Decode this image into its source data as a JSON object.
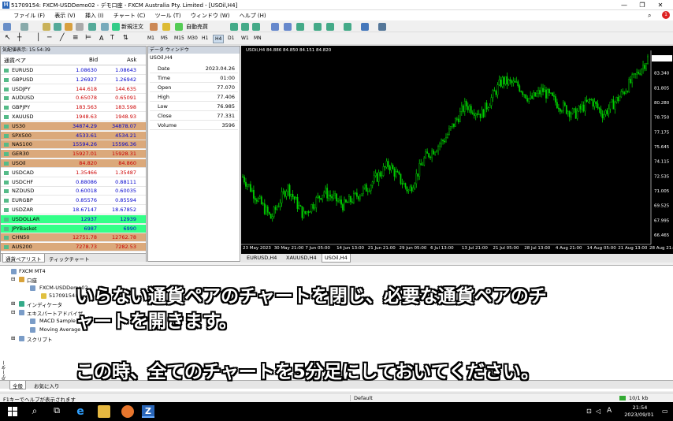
{
  "title_bar": {
    "title": "51709154: FXCM-USDDemo02 - デモ口座 - FXCM Australia Pty. Limited - [USOil,H4]",
    "controls": [
      "—",
      "❐",
      "✕"
    ]
  },
  "menu": [
    "ファイル (F)",
    "表示 (V)",
    "挿入 (I)",
    "チャート (C)",
    "ツール (T)",
    "ウィンドウ (W)",
    "ヘルプ (H)"
  ],
  "toolbar": {
    "new_order": "新規注文",
    "auto_trading": "自動売買"
  },
  "timeframes": [
    "M1",
    "M5",
    "M15",
    "M30",
    "H1",
    "H4",
    "D1",
    "W1",
    "MN"
  ],
  "market_watch": {
    "header": "気配値表示: 15:54:39",
    "columns": {
      "symbol": "通貨ペア",
      "bid": "Bid",
      "ask": "Ask"
    },
    "rows": [
      {
        "symbol": "EURUSD",
        "bid": "1.08630",
        "ask": "1.08643",
        "bg": "#ffffff",
        "color": "#0000cc"
      },
      {
        "symbol": "GBPUSD",
        "bid": "1.26927",
        "ask": "1.26942",
        "bg": "#ffffff",
        "color": "#0000cc"
      },
      {
        "symbol": "USDJPY",
        "bid": "144.618",
        "ask": "144.635",
        "bg": "#ffffff",
        "color": "#cc0000"
      },
      {
        "symbol": "AUDUSD",
        "bid": "0.65078",
        "ask": "0.65091",
        "bg": "#ffffff",
        "color": "#cc0000"
      },
      {
        "symbol": "GBPJPY",
        "bid": "183.563",
        "ask": "183.598",
        "bg": "#ffffff",
        "color": "#cc0000"
      },
      {
        "symbol": "XAUUSD",
        "bid": "1948.63",
        "ask": "1948.93",
        "bg": "#ffffff",
        "color": "#cc0000"
      },
      {
        "symbol": "US30",
        "bid": "34874.29",
        "ask": "34878.07",
        "bg": "#dba97b",
        "color": "#0000cc"
      },
      {
        "symbol": "SPX500",
        "bid": "4533.61",
        "ask": "4534.21",
        "bg": "#dba97b",
        "color": "#0000cc"
      },
      {
        "symbol": "NAS100",
        "bid": "15594.26",
        "ask": "15596.36",
        "bg": "#dba97b",
        "color": "#0000cc"
      },
      {
        "symbol": "GER30",
        "bid": "15927.01",
        "ask": "15928.31",
        "bg": "#dba97b",
        "color": "#cc0000"
      },
      {
        "symbol": "USOil",
        "bid": "84.820",
        "ask": "84.860",
        "bg": "#dba97b",
        "color": "#cc0000"
      },
      {
        "symbol": "USDCAD",
        "bid": "1.35466",
        "ask": "1.35487",
        "bg": "#ffffff",
        "color": "#cc0000"
      },
      {
        "symbol": "USDCHF",
        "bid": "0.88086",
        "ask": "0.88111",
        "bg": "#ffffff",
        "color": "#0000cc"
      },
      {
        "symbol": "NZDUSD",
        "bid": "0.60018",
        "ask": "0.60035",
        "bg": "#ffffff",
        "color": "#0000cc"
      },
      {
        "symbol": "EURGBP",
        "bid": "0.85576",
        "ask": "0.85594",
        "bg": "#ffffff",
        "color": "#0000cc"
      },
      {
        "symbol": "USDZAR",
        "bid": "18.67147",
        "ask": "18.67852",
        "bg": "#ffffff",
        "color": "#0000cc"
      },
      {
        "symbol": "USDOLLAR",
        "bid": "12937",
        "ask": "12939",
        "bg": "#33ff88",
        "color": "#0000cc"
      },
      {
        "symbol": "JPYBasket",
        "bid": "6987",
        "ask": "6990",
        "bg": "#33ff88",
        "color": "#0000cc"
      },
      {
        "symbol": "CHN50",
        "bid": "12751.78",
        "ask": "12762.78",
        "bg": "#dba97b",
        "color": "#cc0000"
      },
      {
        "symbol": "AUS200",
        "bid": "7278.73",
        "ask": "7282.53",
        "bg": "#dba97b",
        "color": "#cc0000"
      }
    ],
    "tabs": [
      "通貨ペアリスト",
      "ティックチャート"
    ]
  },
  "data_window": {
    "header": "データ ウィンドウ",
    "symbol": "USOil,H4",
    "rows": [
      {
        "k": "Date",
        "v": "2023.04.26"
      },
      {
        "k": "Time",
        "v": "01:00"
      },
      {
        "k": "Open",
        "v": "77.070"
      },
      {
        "k": "High",
        "v": "77.406"
      },
      {
        "k": "Low",
        "v": "76.985"
      },
      {
        "k": "Close",
        "v": "77.331"
      },
      {
        "k": "Volume",
        "v": "3596"
      }
    ]
  },
  "chart": {
    "header": "USOil,H4  84.886 84.850 84.151 84.820",
    "price_labels": [
      "84.820",
      "83.340",
      "81.805",
      "80.280",
      "78.750",
      "77.175",
      "75.645",
      "74.115",
      "72.535",
      "71.005",
      "69.525",
      "67.995",
      "66.465"
    ],
    "time_labels": [
      "23 May 2023",
      "30 May 21:00",
      "7 Jun 05:00",
      "14 Jun 13:00",
      "21 Jun 21:00",
      "29 Jun 05:00",
      "6 Jul 13:00",
      "13 Jul 21:00",
      "21 Jul 05:00",
      "28 Jul 13:00",
      "4 Aug 21:00",
      "14 Aug 05:00",
      "21 Aug 13:00",
      "28 Aug 21:00"
    ],
    "tabs": [
      "EURUSD,H4",
      "XAUUSD,H4",
      "USOil,H4"
    ],
    "line_color": "#00cc00",
    "bg_color": "#000000"
  },
  "navigator": {
    "root": "FXCM MT4",
    "accounts": "口座",
    "server": "FXCM-USDDemo02",
    "account_no": "51709154:",
    "indicators": "インディケータ",
    "experts": "エキスパートアドバイザ",
    "expert_items": [
      "MACD Sample",
      "Moving Average"
    ],
    "scripts": "スクリプト",
    "tabs": [
      "全般",
      "お気に入り"
    ],
    "side_label": "ナビゲーター"
  },
  "overlay": {
    "line1": "いらない通貨ペアのチャートを閉じ、必要な通貨ペアのチ",
    "line2": "ャートを開きます。",
    "line3": "この時、全てのチャートを5分足にしておいてください。"
  },
  "status": {
    "help": "F1キーでヘルプが表示されます",
    "profile": "Default",
    "traffic": "10/1 kb"
  },
  "taskbar": {
    "time": "21:54",
    "date": "2023/09/01",
    "ime": "A"
  }
}
